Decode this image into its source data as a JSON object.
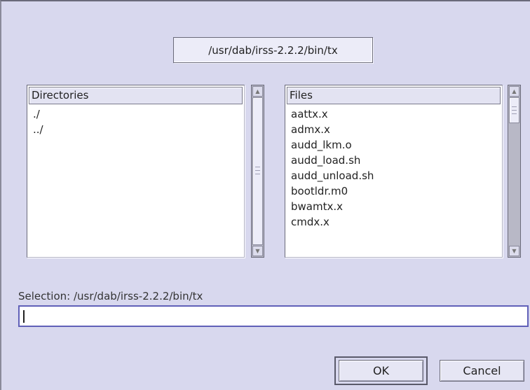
{
  "path_display": "/usr/dab/irss-2.2.2/bin/tx",
  "directories": {
    "header": "Directories",
    "items": [
      "./",
      "../"
    ]
  },
  "files": {
    "header": "Files",
    "items": [
      "aattx.x",
      "admx.x",
      "audd_lkm.o",
      "audd_load.sh",
      "audd_unload.sh",
      "bootldr.m0",
      "bwamtx.x",
      "cmdx.x"
    ]
  },
  "selection": {
    "label": "Selection: /usr/dab/irss-2.2.2/bin/tx",
    "value": ""
  },
  "buttons": {
    "ok": "OK",
    "cancel": "Cancel"
  },
  "icons": {
    "scroll_up": "scroll-up-arrow-icon",
    "scroll_down": "scroll-down-arrow-icon"
  },
  "colors": {
    "background": "#d8d8ee",
    "input_border": "#6060b8"
  }
}
